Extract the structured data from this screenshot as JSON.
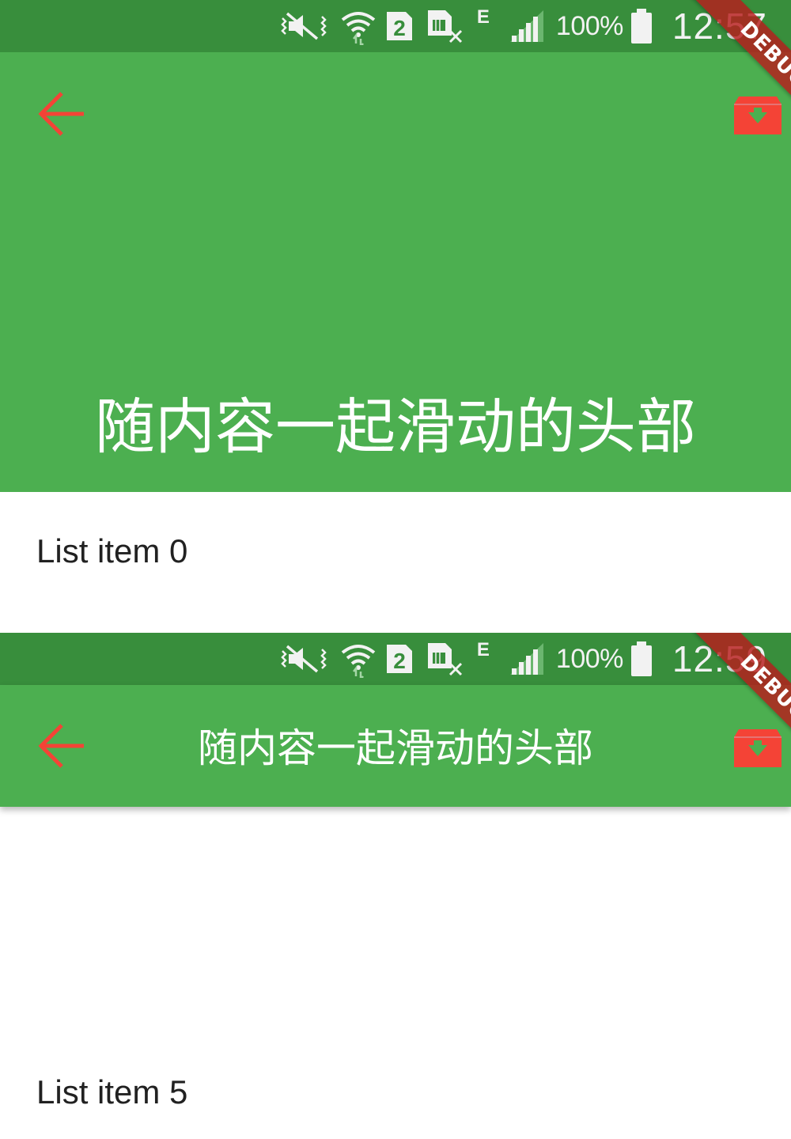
{
  "colors": {
    "status_bar": "#388e3c",
    "app_bar": "#4caf50",
    "back_icon": "#f44336",
    "action_icon": "#f44336",
    "debug_ribbon": "#b71c1c",
    "list_text": "#212121"
  },
  "screens": [
    {
      "state": "expanded",
      "status_bar": {
        "icons": [
          "mute-vibrate-icon",
          "wifi-icon",
          "sim-2-icon",
          "no-sim-icon",
          "edge-network-icon",
          "signal-icon",
          "battery-icon"
        ],
        "network_type": "E",
        "sim_slot": "2",
        "battery": "100%",
        "time": "12:57"
      },
      "app_bar": {
        "title": "随内容一起滑动的头部",
        "back_icon": "arrow-left-icon",
        "action_icon": "inbox-download-icon"
      },
      "debug_label": "DEBUG",
      "list": [
        {
          "label": "List item 0"
        }
      ]
    },
    {
      "state": "collapsed",
      "status_bar": {
        "icons": [
          "mute-vibrate-icon",
          "wifi-icon",
          "sim-2-icon",
          "no-sim-icon",
          "edge-network-icon",
          "signal-icon",
          "battery-icon"
        ],
        "network_type": "E",
        "sim_slot": "2",
        "battery": "100%",
        "time": "12:59"
      },
      "app_bar": {
        "title": "随内容一起滑动的头部",
        "back_icon": "arrow-left-icon",
        "action_icon": "inbox-download-icon"
      },
      "debug_label": "DEBUG",
      "list": [
        {
          "label": "List item 5"
        }
      ]
    }
  ]
}
